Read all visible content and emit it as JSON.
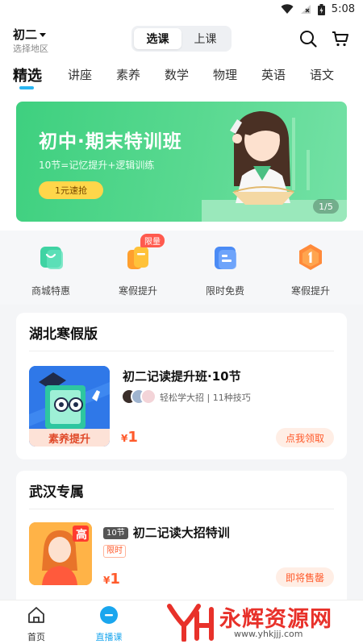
{
  "status_bar": {
    "time": "5:08"
  },
  "header": {
    "grade": "初二",
    "region": "选择地区",
    "segment": {
      "options": [
        "选课",
        "上课"
      ],
      "selected": "选课"
    }
  },
  "tabs": [
    "精选",
    "讲座",
    "素养",
    "数学",
    "物理",
    "英语",
    "语文"
  ],
  "banner": {
    "title": "初中·期末特训班",
    "subtitle": "10节=记忆提升+逻辑训练",
    "button": "1元速抢",
    "page": "1/5"
  },
  "quick_entries": [
    {
      "label": "商城特惠",
      "icon": "shop-bag-icon"
    },
    {
      "label": "寒假提升",
      "icon": "cup-icon",
      "badge": "限量"
    },
    {
      "label": "限时免费",
      "icon": "document-icon"
    },
    {
      "label": "寒假提升",
      "icon": "number-one-badge-icon"
    }
  ],
  "sections": [
    {
      "title": "湖北寒假版",
      "course": {
        "title": "初二记读提升班·10节",
        "thumb_tag": "素养提升",
        "meta": "轻松学大招 | 11种技巧",
        "price_symbol": "¥",
        "price": "1",
        "action": "点我领取"
      }
    },
    {
      "title": "武汉专属",
      "course": {
        "badge": "10节",
        "title": "初二记读大招特训",
        "tag": "限时",
        "thumb_badge": "高",
        "price_symbol": "¥",
        "price": "1",
        "action": "即将售罄"
      }
    }
  ],
  "bottom_nav": [
    {
      "label": "首页",
      "icon": "home-icon",
      "active": false
    },
    {
      "label": "直播课",
      "icon": "live-class-icon",
      "active": true
    }
  ],
  "watermark": {
    "text": "永辉资源网",
    "url": "www.yhkjjj.com"
  },
  "colors": {
    "accent": "#1aa6ee",
    "banner_green": "#3ed07f",
    "price": "#ff5a2b"
  }
}
